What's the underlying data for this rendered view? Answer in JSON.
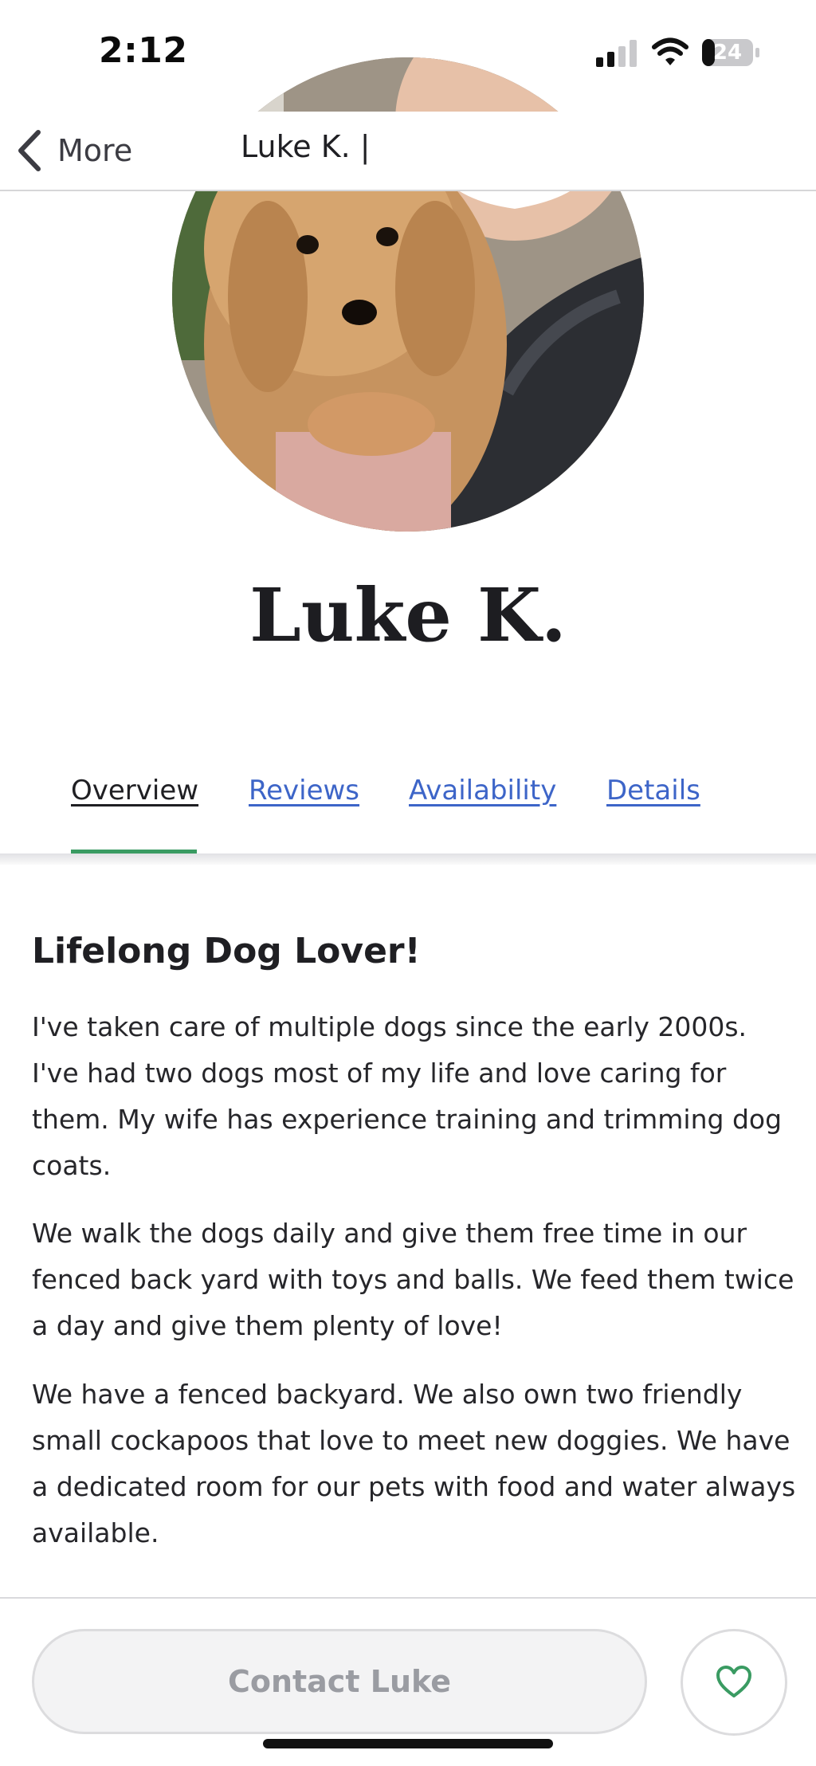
{
  "status_bar": {
    "time": "2:12",
    "battery_level": "24",
    "icons": [
      "signal-icon",
      "wifi-icon",
      "battery-icon"
    ]
  },
  "nav": {
    "back_label": "More",
    "title": "Luke K. |",
    "back_icon": "chevron-left-icon"
  },
  "profile": {
    "name": "Luke K."
  },
  "tabs": [
    {
      "label": "Overview",
      "active": true
    },
    {
      "label": "Reviews",
      "active": false
    },
    {
      "label": "Availability",
      "active": false
    },
    {
      "label": "Details",
      "active": false
    }
  ],
  "about": {
    "heading": "Lifelong Dog Lover!",
    "paragraphs": [
      "I've taken care of multiple dogs since the early 2000s. I've had two dogs most of my life and love caring for them. My wife has experience training and trimming dog coats.",
      "We walk the dogs daily and give them free time in our fenced back yard with toys and balls. We feed them twice a day and give them plenty of love!",
      "We have a fenced backyard. We also own two friendly small cockapoos that love to meet new doggies. We have a dedicated room for our pets with food and water always available."
    ]
  },
  "actions": {
    "contact_label": "Contact Luke",
    "favorite_icon": "heart-icon"
  },
  "colors": {
    "accent_green": "#3a9b62",
    "link_blue": "#3d65c8",
    "text_dark": "#1f1f23",
    "button_disabled_text": "#9a9ca2"
  }
}
